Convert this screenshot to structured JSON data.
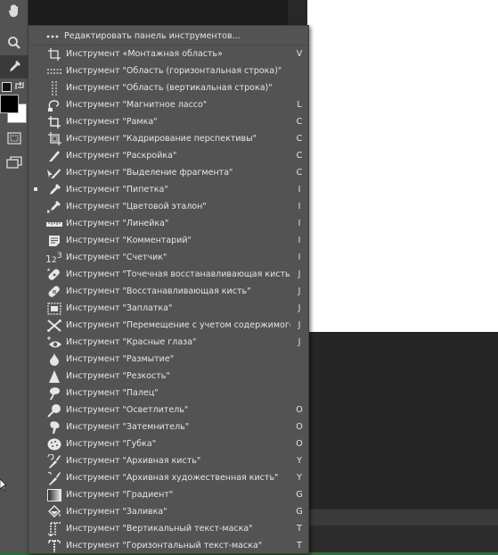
{
  "menu": {
    "edit_toolbar": "Редактировать панель инструментов...",
    "items": [
      {
        "label": "Инструмент «Монтажная область»",
        "key": "V",
        "icon": "artboard-icon",
        "active": false
      },
      {
        "label": "Инструмент \"Область (горизонтальная строка)\"",
        "key": "",
        "icon": "single-row-marquee-icon",
        "active": false
      },
      {
        "label": "Инструмент \"Область (вертикальная строка)\"",
        "key": "",
        "icon": "single-column-marquee-icon",
        "active": false
      },
      {
        "label": "Инструмент \"Магнитное лассо\"",
        "key": "L",
        "icon": "magnetic-lasso-icon",
        "active": false
      },
      {
        "label": "Инструмент \"Рамка\"",
        "key": "C",
        "icon": "crop-icon",
        "active": false
      },
      {
        "label": "Инструмент \"Кадрирование перспективы\"",
        "key": "C",
        "icon": "perspective-crop-icon",
        "active": false
      },
      {
        "label": "Инструмент \"Раскройка\"",
        "key": "C",
        "icon": "slice-icon",
        "active": false
      },
      {
        "label": "Инструмент \"Выделение фрагмента\"",
        "key": "C",
        "icon": "slice-select-icon",
        "active": false
      },
      {
        "label": "Инструмент \"Пипетка\"",
        "key": "I",
        "icon": "eyedropper-icon",
        "active": true
      },
      {
        "label": "Инструмент \"Цветовой эталон\"",
        "key": "I",
        "icon": "color-sampler-icon",
        "active": false
      },
      {
        "label": "Инструмент \"Линейка\"",
        "key": "I",
        "icon": "ruler-icon",
        "active": false
      },
      {
        "label": "Инструмент \"Комментарий\"",
        "key": "I",
        "icon": "note-icon",
        "active": false
      },
      {
        "label": "Инструмент \"Счетчик\"",
        "key": "I",
        "icon": "count-icon",
        "active": false
      },
      {
        "label": "Инструмент \"Точечная восстанавливающая кисть\"",
        "key": "J",
        "icon": "spot-healing-icon",
        "active": false
      },
      {
        "label": "Инструмент \"Восстанавливающая кисть\"",
        "key": "J",
        "icon": "healing-brush-icon",
        "active": false
      },
      {
        "label": "Инструмент \"Заплатка\"",
        "key": "J",
        "icon": "patch-icon",
        "active": false
      },
      {
        "label": "Инструмент \"Перемещение с учетом содержимого\"",
        "key": "J",
        "icon": "content-aware-move-icon",
        "active": false
      },
      {
        "label": "Инструмент \"Красные глаза\"",
        "key": "J",
        "icon": "red-eye-icon",
        "active": false
      },
      {
        "label": "Инструмент \"Размытие\"",
        "key": "",
        "icon": "blur-icon",
        "active": false
      },
      {
        "label": "Инструмент \"Резкость\"",
        "key": "",
        "icon": "sharpen-icon",
        "active": false
      },
      {
        "label": "Инструмент \"Палец\"",
        "key": "",
        "icon": "smudge-icon",
        "active": false
      },
      {
        "label": "Инструмент \"Осветлитель\"",
        "key": "O",
        "icon": "dodge-icon",
        "active": false
      },
      {
        "label": "Инструмент \"Затемнитель\"",
        "key": "O",
        "icon": "burn-icon",
        "active": false
      },
      {
        "label": "Инструмент \"Губка\"",
        "key": "O",
        "icon": "sponge-icon",
        "active": false
      },
      {
        "label": "Инструмент \"Архивная кисть\"",
        "key": "Y",
        "icon": "history-brush-icon",
        "active": false
      },
      {
        "label": "Инструмент \"Архивная художественная кисть\"",
        "key": "Y",
        "icon": "art-history-brush-icon",
        "active": false
      },
      {
        "label": "Инструмент \"Градиент\"",
        "key": "G",
        "icon": "gradient-icon",
        "active": false
      },
      {
        "label": "Инструмент \"Заливка\"",
        "key": "G",
        "icon": "paint-bucket-icon",
        "active": false
      },
      {
        "label": "Инструмент \"Вертикальный текст-маска\"",
        "key": "T",
        "icon": "vertical-type-mask-icon",
        "active": false
      },
      {
        "label": "Инструмент \"Горизонтальный текст-маска\"",
        "key": "T",
        "icon": "horizontal-type-mask-icon",
        "active": false
      }
    ]
  },
  "toolbar": {
    "icons": [
      "hand-icon",
      "zoom-icon",
      "eyedropper-icon",
      "swap-colors-icon",
      "foreground-color",
      "background-color",
      "quick-mask-icon",
      "screen-mode-icon"
    ],
    "foreground_color": "#000000",
    "background_color": "#ffffff"
  },
  "colors": {
    "panel_bg": "#535353",
    "menu_text": "#e6e6e6",
    "document": "#ffffff"
  }
}
